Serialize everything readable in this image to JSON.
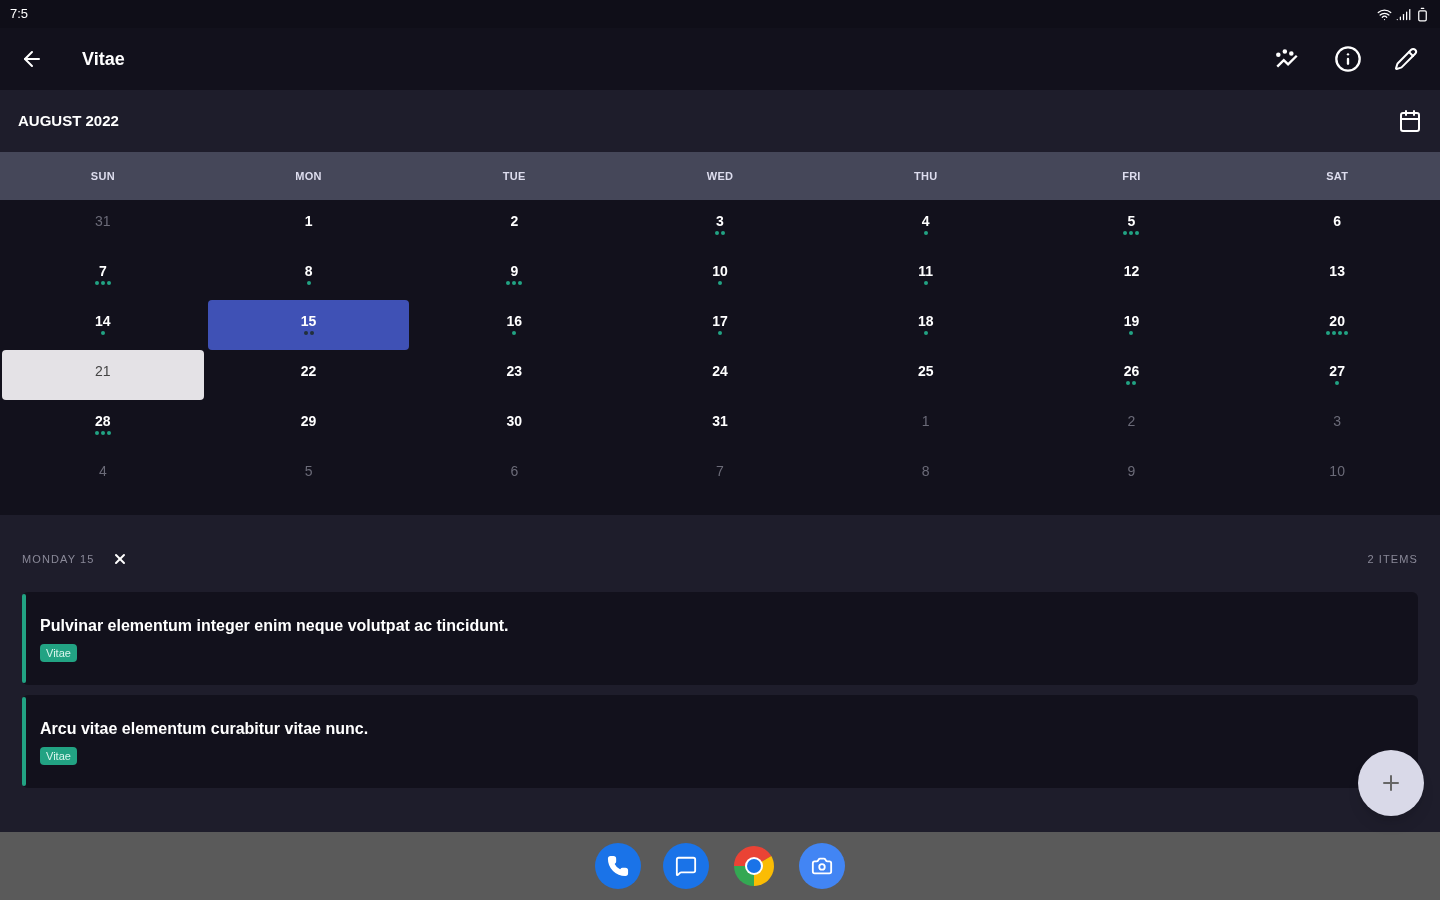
{
  "status_bar": {
    "time": "7:5"
  },
  "app_bar": {
    "title": "Vitae"
  },
  "calendar": {
    "month": "AUGUST 2022",
    "weekdays": [
      "SUN",
      "MON",
      "TUE",
      "WED",
      "THU",
      "FRI",
      "SAT"
    ],
    "days": [
      {
        "label": "31",
        "outside": true,
        "selected": false,
        "today": false
      },
      {
        "label": "1",
        "outside": false,
        "selected": false,
        "today": false
      },
      {
        "label": "2",
        "outside": false,
        "selected": false,
        "today": false
      },
      {
        "label": "3",
        "outside": false,
        "selected": false,
        "today": false,
        "events": [
          {
            "color": "#22a383"
          },
          {
            "color": "#22a383"
          }
        ]
      },
      {
        "label": "4",
        "outside": false,
        "selected": false,
        "today": false,
        "events": [
          {
            "color": "#22a383"
          }
        ]
      },
      {
        "label": "5",
        "outside": false,
        "selected": false,
        "today": false,
        "events": [
          {
            "color": "#22a383"
          },
          {
            "color": "#22a383"
          },
          {
            "color": "#22a383"
          }
        ]
      },
      {
        "label": "6",
        "outside": false,
        "selected": false,
        "today": false
      },
      {
        "label": "7",
        "outside": false,
        "selected": false,
        "today": false,
        "events": [
          {
            "color": "#22a383"
          },
          {
            "color": "#22a383"
          },
          {
            "color": "#22a383"
          }
        ]
      },
      {
        "label": "8",
        "outside": false,
        "selected": false,
        "today": false,
        "events": [
          {
            "color": "#22a383"
          }
        ]
      },
      {
        "label": "9",
        "outside": false,
        "selected": false,
        "today": false,
        "events": [
          {
            "color": "#22a383"
          },
          {
            "color": "#22a383"
          },
          {
            "color": "#22a383"
          }
        ]
      },
      {
        "label": "10",
        "outside": false,
        "selected": false,
        "today": false,
        "events": [
          {
            "color": "#22a383"
          }
        ]
      },
      {
        "label": "11",
        "outside": false,
        "selected": false,
        "today": false,
        "events": [
          {
            "color": "#22a383"
          }
        ]
      },
      {
        "label": "12",
        "outside": false,
        "selected": false,
        "today": false
      },
      {
        "label": "13",
        "outside": false,
        "selected": false,
        "today": false
      },
      {
        "label": "14",
        "outside": false,
        "selected": false,
        "today": false,
        "events": [
          {
            "color": "#22a383"
          }
        ]
      },
      {
        "label": "15",
        "outside": false,
        "selected": true,
        "today": false,
        "events": [
          {
            "color": "#22303a"
          },
          {
            "color": "#22303a"
          }
        ]
      },
      {
        "label": "16",
        "outside": false,
        "selected": false,
        "today": false,
        "events": [
          {
            "color": "#22a383"
          }
        ]
      },
      {
        "label": "17",
        "outside": false,
        "selected": false,
        "today": false,
        "events": [
          {
            "color": "#22a383"
          }
        ]
      },
      {
        "label": "18",
        "outside": false,
        "selected": false,
        "today": false,
        "events": [
          {
            "color": "#22a383"
          }
        ]
      },
      {
        "label": "19",
        "outside": false,
        "selected": false,
        "today": false,
        "events": [
          {
            "color": "#22a383"
          }
        ]
      },
      {
        "label": "20",
        "outside": false,
        "selected": false,
        "today": false,
        "events": [
          {
            "color": "#22a383"
          },
          {
            "color": "#22a383"
          },
          {
            "color": "#22a383"
          },
          {
            "color": "#22a383"
          }
        ]
      },
      {
        "label": "21",
        "outside": false,
        "selected": false,
        "today": true
      },
      {
        "label": "22",
        "outside": false,
        "selected": false,
        "today": false
      },
      {
        "label": "23",
        "outside": false,
        "selected": false,
        "today": false
      },
      {
        "label": "24",
        "outside": false,
        "selected": false,
        "today": false
      },
      {
        "label": "25",
        "outside": false,
        "selected": false,
        "today": false
      },
      {
        "label": "26",
        "outside": false,
        "selected": false,
        "today": false,
        "events": [
          {
            "color": "#22a383"
          },
          {
            "color": "#22a383"
          }
        ]
      },
      {
        "label": "27",
        "outside": false,
        "selected": false,
        "today": false,
        "events": [
          {
            "color": "#22a383"
          }
        ]
      },
      {
        "label": "28",
        "outside": false,
        "selected": false,
        "today": false,
        "events": [
          {
            "color": "#22a383"
          },
          {
            "color": "#22a383"
          },
          {
            "color": "#22a383"
          }
        ]
      },
      {
        "label": "29",
        "outside": false,
        "selected": false,
        "today": false
      },
      {
        "label": "30",
        "outside": false,
        "selected": false,
        "today": false
      },
      {
        "label": "31",
        "outside": false,
        "selected": false,
        "today": false
      },
      {
        "label": "1",
        "outside": true,
        "selected": false,
        "today": false
      },
      {
        "label": "2",
        "outside": true,
        "selected": false,
        "today": false
      },
      {
        "label": "3",
        "outside": true,
        "selected": false,
        "today": false
      },
      {
        "label": "4",
        "outside": true,
        "selected": false,
        "today": false
      },
      {
        "label": "5",
        "outside": true,
        "selected": false,
        "today": false
      },
      {
        "label": "6",
        "outside": true,
        "selected": false,
        "today": false
      },
      {
        "label": "7",
        "outside": true,
        "selected": false,
        "today": false
      },
      {
        "label": "8",
        "outside": true,
        "selected": false,
        "today": false
      },
      {
        "label": "9",
        "outside": true,
        "selected": false,
        "today": false
      },
      {
        "label": "10",
        "outside": true,
        "selected": false,
        "today": false
      }
    ]
  },
  "day_panel": {
    "title": "MONDAY 15",
    "count": "2 ITEMS",
    "items": [
      {
        "text": "Pulvinar elementum integer enim neque volutpat ac tincidunt.",
        "tag": "Vitae",
        "color": "#22a383"
      },
      {
        "text": "Arcu vitae elementum curabitur vitae nunc.",
        "tag": "Vitae",
        "color": "#22a383"
      }
    ]
  }
}
